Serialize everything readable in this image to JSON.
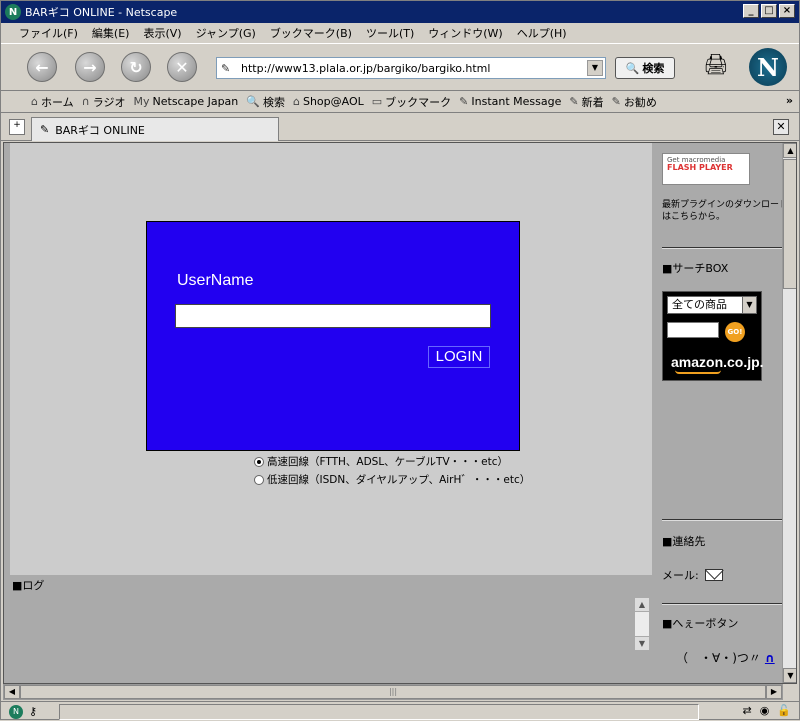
{
  "window": {
    "title": "BARギコ ONLINE - Netscape"
  },
  "menu": [
    "ファイル(F)",
    "編集(E)",
    "表示(V)",
    "ジャンプ(G)",
    "ブックマーク(B)",
    "ツール(T)",
    "ウィンドウ(W)",
    "ヘルプ(H)"
  ],
  "nav": {
    "url": "http://www13.plala.or.jp/bargiko/bargiko.html",
    "search_label": "検索"
  },
  "personal_toolbar": [
    {
      "label": "ホーム",
      "icon": "home-icon"
    },
    {
      "label": "ラジオ",
      "icon": "radio-icon"
    },
    {
      "label": "Netscape Japan",
      "icon": "my-icon"
    },
    {
      "label": "検索",
      "icon": "search-icon"
    },
    {
      "label": "Shop@AOL",
      "icon": "shop-icon"
    },
    {
      "label": "ブックマーク",
      "icon": "bookmark-icon"
    },
    {
      "label": "Instant Message",
      "icon": "link-icon"
    },
    {
      "label": "新着",
      "icon": "link-icon"
    },
    {
      "label": "お勧め",
      "icon": "link-icon"
    }
  ],
  "tab": {
    "label": "BARギコ ONLINE"
  },
  "login": {
    "username_label": "UserName",
    "username_value": "",
    "login_button": "LOGIN",
    "options": [
      {
        "label": "高速回線（FTTH、ADSL、ケーブルTV・・・etc）",
        "selected": true
      },
      {
        "label": "低速回線（ISDN、ダイヤルアップ、AirH゛・・・etc）",
        "selected": false
      }
    ]
  },
  "log": {
    "label": "■ログ"
  },
  "sidebar": {
    "flash_top": "Get macromedia",
    "flash_name": "FLASH PLAYER",
    "plugin_text_1": "最新プラグインのダウンロード",
    "plugin_text_2": "はこちらから。",
    "search_heading": "■サーチBOX",
    "amazon_select": "全ての商品",
    "amazon_go": "GO!",
    "amazon_logo": "amazon.co.jp.",
    "contact_heading": "■連絡先",
    "mail_label": "メール:",
    "hee_heading": "■へぇーボタン",
    "hee_face": "（　・∀・)つ〃",
    "hee_link": "∩"
  },
  "colors": {
    "login_bg": "#2200f0",
    "frame_bg": "#cccccc",
    "page_bg": "#aaaaaa"
  }
}
